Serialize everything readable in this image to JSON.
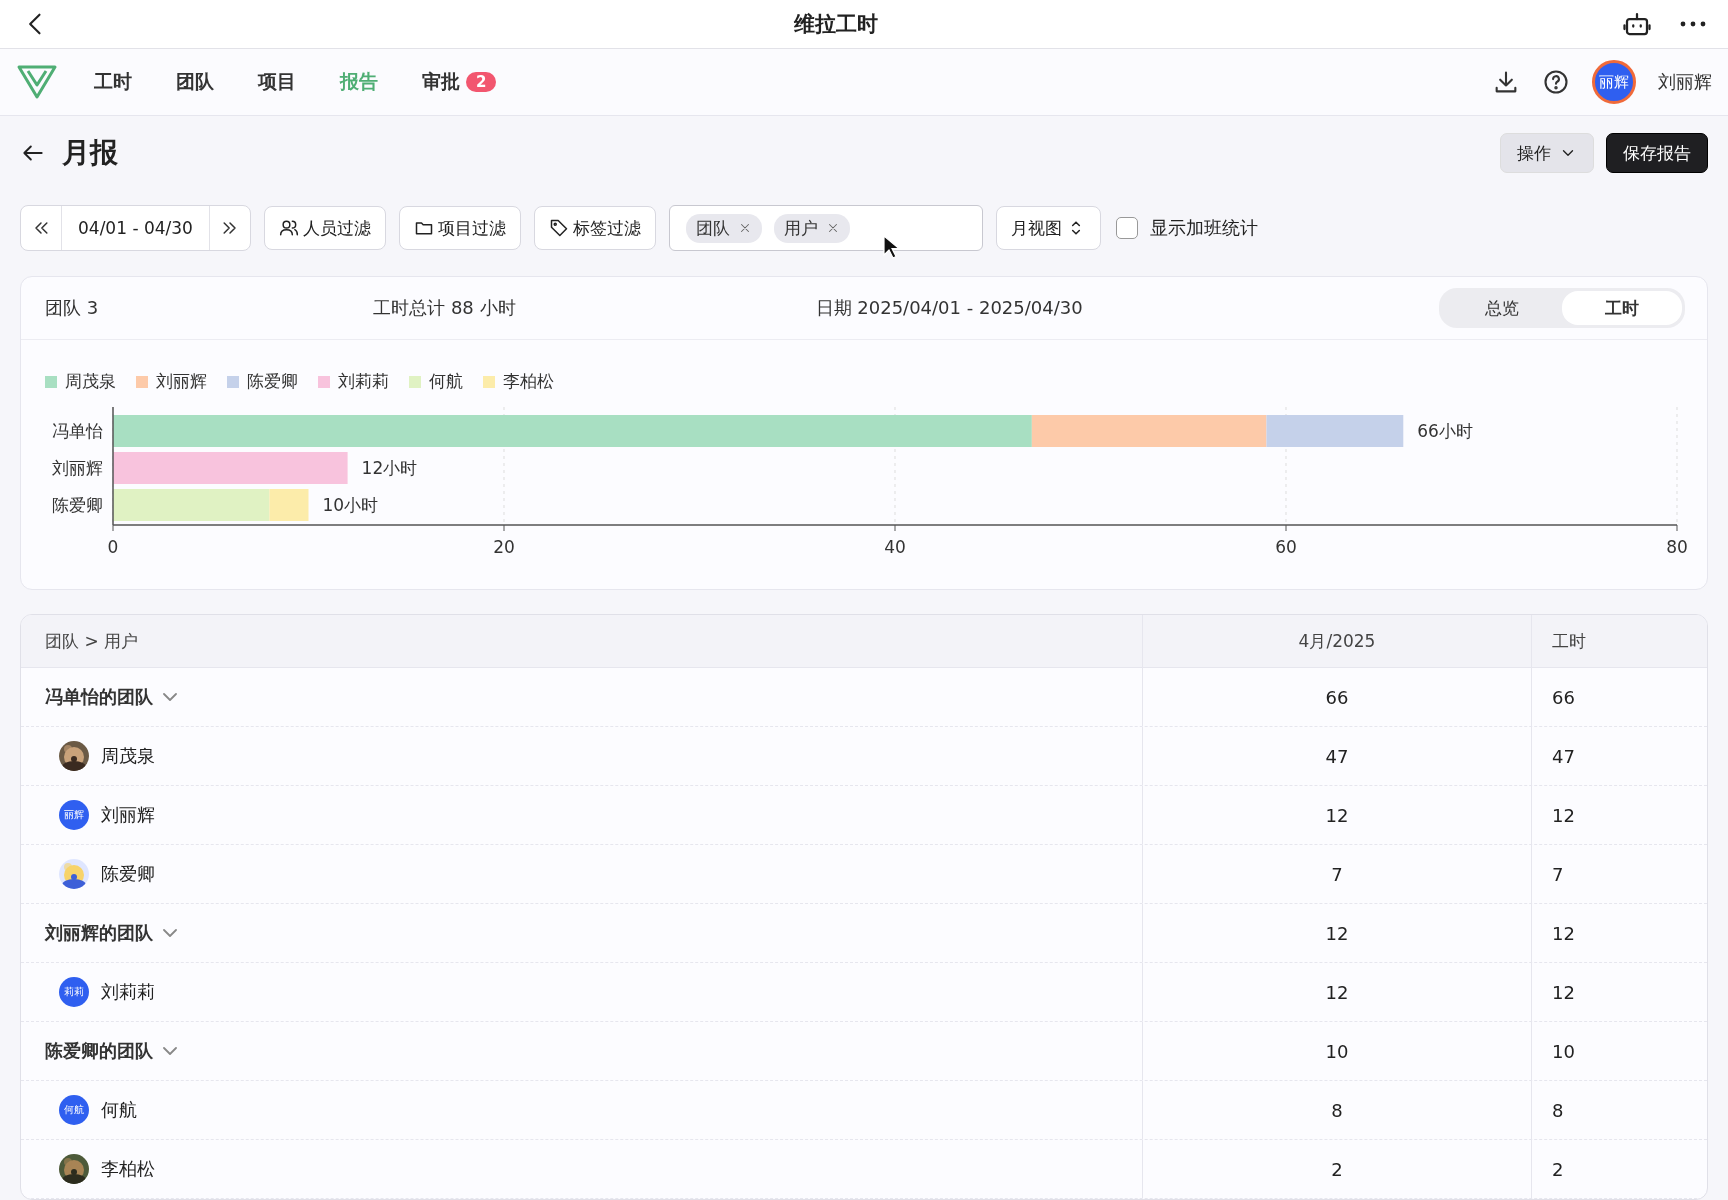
{
  "window": {
    "title": "维拉工时"
  },
  "nav": {
    "items": [
      {
        "label": "工时",
        "selected": false
      },
      {
        "label": "团队",
        "selected": false
      },
      {
        "label": "项目",
        "selected": false
      },
      {
        "label": "报告",
        "selected": true
      },
      {
        "label": "审批",
        "selected": false,
        "badge": "2"
      }
    ],
    "user": {
      "avatar_text": "丽辉",
      "name": "刘丽辉"
    }
  },
  "page": {
    "title": "月报",
    "buttons": [
      {
        "label": "操作",
        "kind": "menu"
      },
      {
        "label": "保存报告",
        "kind": "primary"
      }
    ]
  },
  "toolbar": {
    "date_range": "04/01 - 04/30",
    "filters": [
      "人员过滤",
      "项目过滤",
      "标签过滤"
    ],
    "group_tags": [
      "团队",
      "用户"
    ],
    "view": "月视图",
    "overtime": {
      "label": "显示加班统计",
      "checked": false
    }
  },
  "summary": {
    "team": "团队 3",
    "total": "工时总计 88 小时",
    "date": "日期 2025/04/01 - 2025/04/30",
    "tabs": [
      {
        "label": "总览",
        "selected": false
      },
      {
        "label": "工时",
        "selected": true
      }
    ]
  },
  "chart_data": {
    "type": "bar",
    "orientation": "horizontal",
    "stacked": true,
    "categories": [
      "冯单怡",
      "刘丽辉",
      "陈爱卿"
    ],
    "series": [
      {
        "name": "周茂泉",
        "color": "#a8dfc2",
        "values": [
          47,
          0,
          0
        ]
      },
      {
        "name": "刘丽辉",
        "color": "#fdcaa9",
        "values": [
          12,
          0,
          0
        ]
      },
      {
        "name": "陈爱卿",
        "color": "#c5d1ea",
        "values": [
          7,
          0,
          0
        ]
      },
      {
        "name": "刘莉莉",
        "color": "#f8c3dd",
        "values": [
          0,
          12,
          0
        ]
      },
      {
        "name": "何航",
        "color": "#e0f2c3",
        "values": [
          0,
          0,
          8
        ]
      },
      {
        "name": "李柏松",
        "color": "#fcecaa",
        "values": [
          0,
          0,
          2
        ]
      }
    ],
    "xlim": [
      0,
      80
    ],
    "grid": true,
    "xticks": [
      0,
      20,
      40,
      60,
      80
    ],
    "value_labels": [
      "66小时",
      "12小时",
      "10小时"
    ]
  },
  "table": {
    "columns": [
      "团队 > 用户",
      "4月/2025",
      "工时"
    ],
    "rows": [
      {
        "kind": "group",
        "name": "冯单怡的团队",
        "expanded": true,
        "month": "66",
        "hours": "66"
      },
      {
        "kind": "user",
        "name": "周茂泉",
        "month": "47",
        "hours": "47"
      },
      {
        "kind": "user",
        "name": "刘丽辉",
        "avatar_text": "丽辉",
        "month": "12",
        "hours": "12"
      },
      {
        "kind": "user",
        "name": "陈爱卿",
        "month": "7",
        "hours": "7"
      },
      {
        "kind": "group",
        "name": "刘丽辉的团队",
        "expanded": true,
        "month": "12",
        "hours": "12"
      },
      {
        "kind": "user",
        "name": "刘莉莉",
        "avatar_text": "莉莉",
        "month": "12",
        "hours": "12"
      },
      {
        "kind": "group",
        "name": "陈爱卿的团队",
        "expanded": true,
        "month": "10",
        "hours": "10"
      },
      {
        "kind": "user",
        "name": "何航",
        "avatar_text": "何航",
        "month": "8",
        "hours": "8"
      },
      {
        "kind": "user",
        "name": "李柏松",
        "month": "2",
        "hours": "2"
      }
    ]
  }
}
